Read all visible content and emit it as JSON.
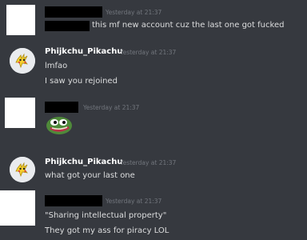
{
  "messages": [
    {
      "timestamp": "Yesterday at 21:37",
      "lines": [
        "this mf new account cuz the last one got fucked"
      ]
    },
    {
      "username": "Phijkchu_Pikachu",
      "timestamp": "Yesterday at 21:37",
      "lines": [
        "lmfao",
        "I saw you rejoined"
      ]
    },
    {
      "timestamp": "Yesterday at 21:37",
      "emoji": "frog-emoji"
    },
    {
      "username": "Phijkchu_Pikachu",
      "timestamp": "Yesterday at 21:37",
      "lines": [
        "what got your last one"
      ]
    },
    {
      "timestamp": "Yesterday at 21:37",
      "lines": [
        "\"Sharing intellectual property\"",
        "They got my ass for piracy LOL"
      ]
    }
  ]
}
